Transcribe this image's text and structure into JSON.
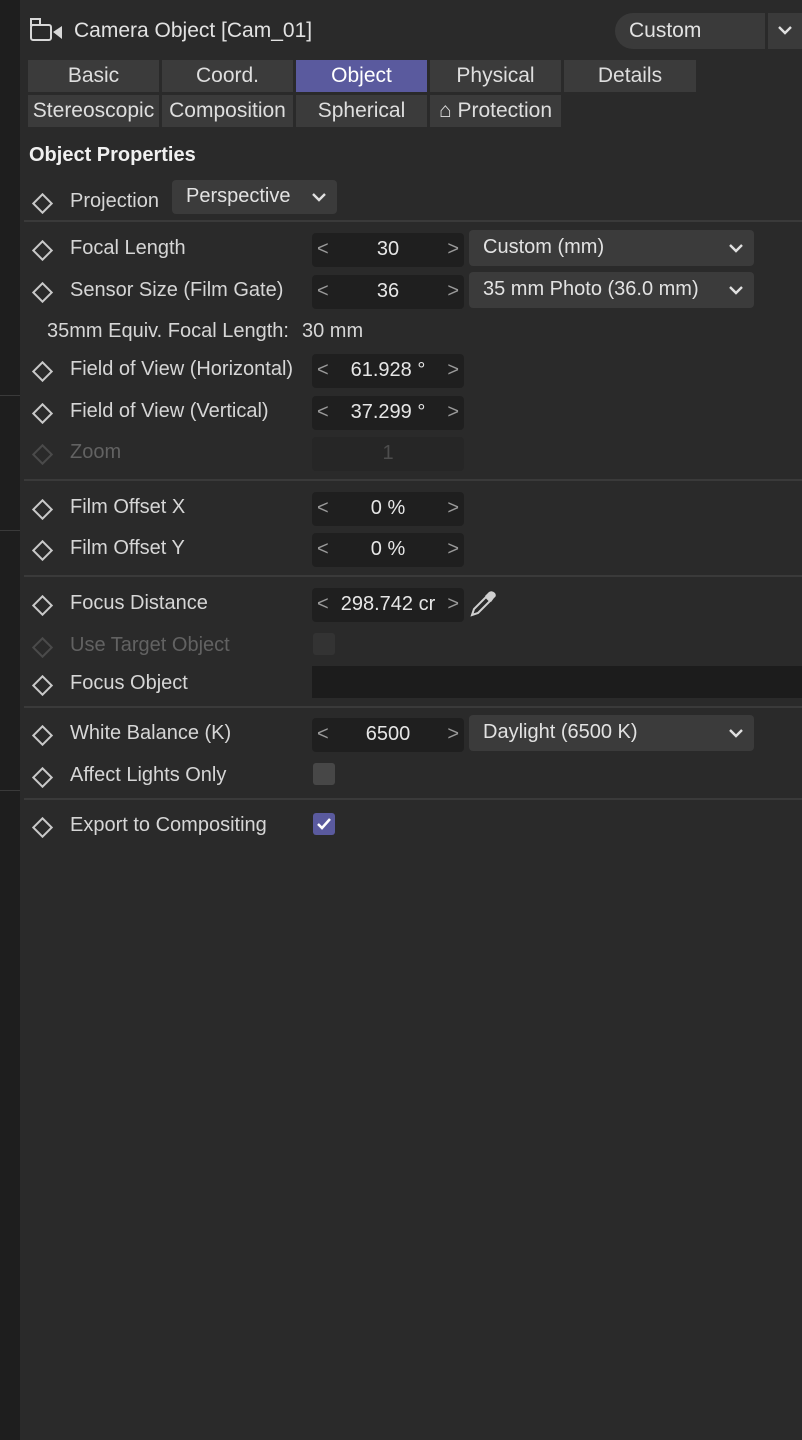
{
  "header": {
    "title": "Camera Object [Cam_01]",
    "preset": "Custom"
  },
  "tabs": [
    {
      "label": "Basic"
    },
    {
      "label": "Coord."
    },
    {
      "label": "Object"
    },
    {
      "label": "Physical"
    },
    {
      "label": "Details"
    },
    {
      "label": "Stereoscopic"
    },
    {
      "label": "Composition"
    },
    {
      "label": "Spherical"
    },
    {
      "label": "⌂ Protection"
    }
  ],
  "active_tab": "Object",
  "section": {
    "title": "Object Properties"
  },
  "fields": {
    "projection": {
      "label": "Projection",
      "value": "Perspective"
    },
    "focal_length": {
      "label": "Focal Length",
      "value": "30",
      "option": "Custom (mm)"
    },
    "sensor_size": {
      "label": "Sensor Size (Film Gate)",
      "value": "36",
      "option": "35 mm Photo (36.0 mm)"
    },
    "equiv_focal": {
      "label": "35mm Equiv. Focal Length:",
      "value": "30 mm"
    },
    "fov_h": {
      "label": "Field of View (Horizontal)",
      "value": "61.928 °"
    },
    "fov_v": {
      "label": "Field of View (Vertical)",
      "value": "37.299 °"
    },
    "zoom": {
      "label": "Zoom",
      "value": "1"
    },
    "film_offset_x": {
      "label": "Film Offset X",
      "value": "0 %"
    },
    "film_offset_y": {
      "label": "Film Offset Y",
      "value": "0 %"
    },
    "focus_distance": {
      "label": "Focus Distance",
      "value": "298.742 cr"
    },
    "use_target": {
      "label": "Use Target Object",
      "checked": false
    },
    "focus_object": {
      "label": "Focus Object",
      "value": ""
    },
    "white_balance": {
      "label": "White Balance (K)",
      "value": "6500",
      "option": "Daylight (6500 K)"
    },
    "affect_lights": {
      "label": "Affect Lights Only",
      "checked": false
    },
    "export_comp": {
      "label": "Export to Compositing",
      "checked": true
    }
  },
  "spinner_arrows": {
    "left": "<",
    "right": ">"
  },
  "colors": {
    "accent": "#5a5a9e",
    "background": "#2a2a2a",
    "field": "#1f1f1f"
  }
}
